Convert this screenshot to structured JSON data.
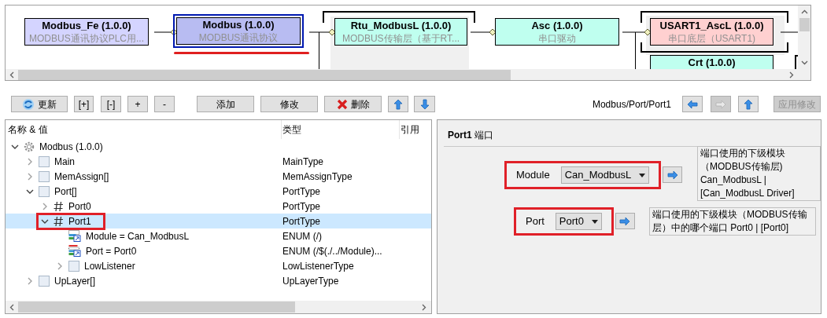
{
  "diagram": {
    "nodes": [
      {
        "title": "Modbus_Fe (1.0.0)",
        "subtitle": "MODBUS通讯协议PLC用...",
        "color": "#d4d4ff",
        "selected": false
      },
      {
        "title": "Modbus (1.0.0)",
        "subtitle": "MODBUS通讯协议",
        "color": "#b8bcf2",
        "selected": true
      },
      {
        "title": "Rtu_ModbusL (1.0.0)",
        "subtitle": "MODBUS传输层（基于RT...",
        "color": "#bfffef",
        "selected": false
      },
      {
        "title": "Asc (1.0.0)",
        "subtitle": "串口驱动",
        "color": "#bfffef",
        "selected": false
      },
      {
        "title": "USART1_AscL (1.0.0)",
        "subtitle": "串口底层（USART1)",
        "color": "#ffd0d0",
        "selected": false
      },
      {
        "title": "Crt (1.0.0)",
        "color": "#bfffef",
        "selected": false
      }
    ]
  },
  "toolbar": {
    "buttons": [
      {
        "kind": "refresh",
        "label": "更新"
      },
      {
        "kind": "text",
        "label": "[+]"
      },
      {
        "kind": "text",
        "label": "[-]"
      },
      {
        "kind": "text",
        "label": "+"
      },
      {
        "kind": "text",
        "label": "-"
      },
      {
        "kind": "text",
        "label": "添加"
      },
      {
        "kind": "text",
        "label": "修改"
      },
      {
        "kind": "delete",
        "label": "删除"
      },
      {
        "kind": "up"
      },
      {
        "kind": "down"
      }
    ],
    "path": "Modbus/Port/Port1",
    "nav": [
      {
        "kind": "back",
        "disabled": false
      },
      {
        "kind": "forward",
        "disabled": true
      },
      {
        "kind": "up",
        "disabled": false
      },
      {
        "kind": "text",
        "label": "应用修改",
        "disabled": true
      }
    ]
  },
  "tree": {
    "columns": [
      "名称 & 值",
      "类型",
      "引用"
    ],
    "items": [
      {
        "kind": "module",
        "label": "Modbus (1.0.0)",
        "expanded": true,
        "selected": false,
        "highlighted": false,
        "children": [
          {
            "kind": "folder",
            "label": "Main",
            "type": "MainType",
            "expanded": false,
            "selected": false,
            "highlighted": false
          },
          {
            "kind": "folder",
            "label": "MemAssign[]",
            "type": "MemAssignType",
            "expanded": false,
            "selected": false,
            "highlighted": false
          },
          {
            "kind": "folder",
            "label": "Port[]",
            "type": "PortType",
            "expanded": true,
            "selected": false,
            "highlighted": false,
            "children": [
              {
                "kind": "index",
                "label": "Port0",
                "type": "PortType",
                "expanded": false,
                "selected": false,
                "highlighted": false
              },
              {
                "kind": "index",
                "label": "Port1",
                "type": "PortType",
                "expanded": true,
                "selected": true,
                "highlighted": true,
                "children": [
                  {
                    "kind": "enum",
                    "label": "Module = Can_ModbusL",
                    "type": "ENUM (/)",
                    "selected": false,
                    "highlighted": false
                  },
                  {
                    "kind": "enum-changed",
                    "label": "Port = Port0",
                    "type": "ENUM (/$(./../Module)...",
                    "selected": false,
                    "highlighted": false
                  },
                  {
                    "kind": "folder",
                    "label": "LowListener",
                    "type": "LowListenerType",
                    "expanded": false,
                    "selected": false,
                    "highlighted": false
                  }
                ]
              }
            ]
          },
          {
            "kind": "folder",
            "label": "UpLayer[]",
            "type": "UpLayerType",
            "expanded": false,
            "selected": false,
            "highlighted": false
          }
        ]
      }
    ]
  },
  "detail": {
    "title": "**Port1** 端口",
    "fields": [
      {
        "label": "Module",
        "value": "Can_ModbusL",
        "highlighted": true,
        "description": "端口使用的下级模块（MODBUS传输层) Can_ModbusL | [Can_ModbusL Driver]"
      },
      {
        "label": "Port",
        "value": "Port0",
        "highlighted": true,
        "description": "端口使用的下级模块（MODBUS传输层）中的哪个端口 Port0 | [Port0]"
      }
    ]
  }
}
